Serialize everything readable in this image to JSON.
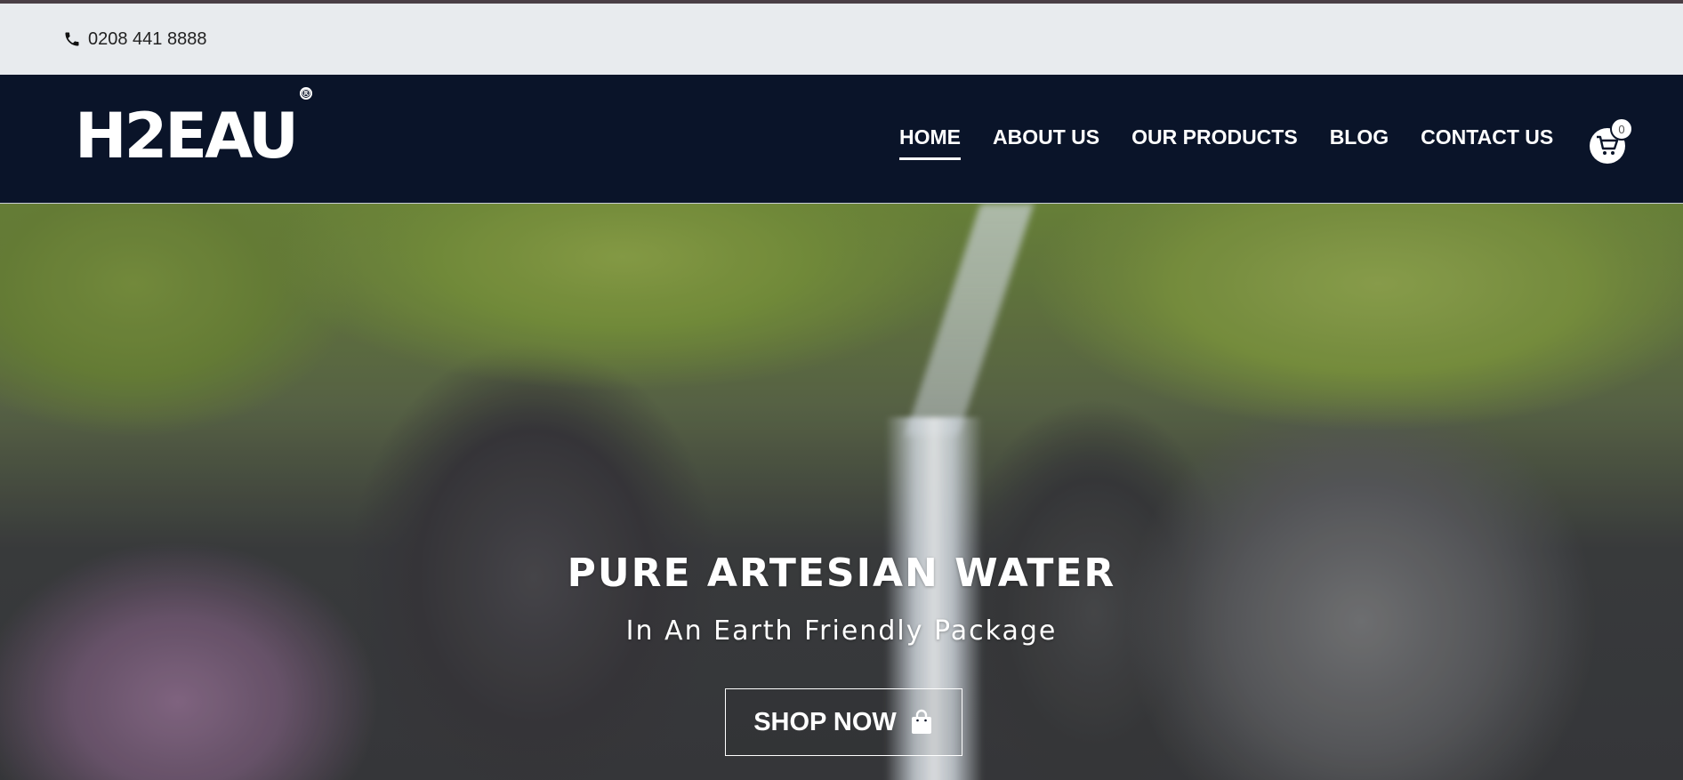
{
  "topbar": {
    "phone_icon": "phone-icon",
    "phone_number": "0208 441 8888"
  },
  "header": {
    "logo_text": "H2EAU",
    "logo_mark": "®",
    "nav": [
      {
        "label": "HOME",
        "active": true
      },
      {
        "label": "ABOUT US",
        "active": false
      },
      {
        "label": "OUR PRODUCTS",
        "active": false
      },
      {
        "label": "BLOG",
        "active": false
      },
      {
        "label": "CONTACT US",
        "active": false
      }
    ],
    "cart_icon": "cart-icon",
    "cart_count": "0"
  },
  "hero": {
    "title": "PURE ARTESIAN WATER",
    "subtitle": "In An Earth Friendly Package",
    "button_label": "SHOP NOW",
    "button_icon": "shopping-bag-icon"
  },
  "colors": {
    "header_bg": "#0a1429",
    "topbar_bg": "#e8ebee",
    "text_light": "#ffffff"
  }
}
